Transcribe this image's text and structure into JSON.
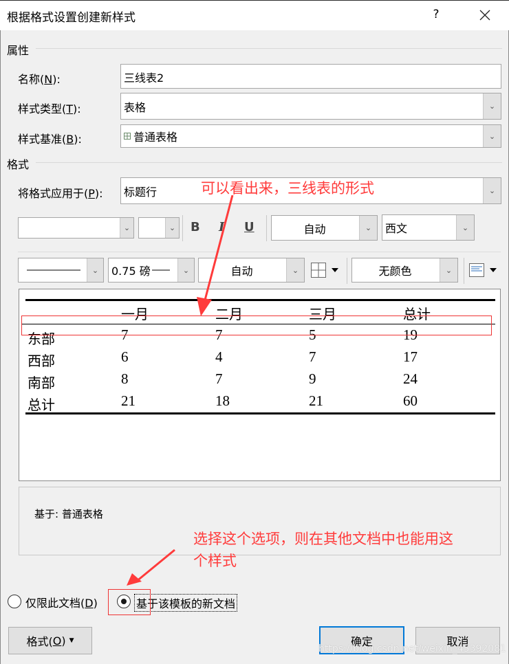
{
  "dialog": {
    "title": "根据格式设置创建新样式",
    "help_label": "?",
    "close_icon": "close-icon"
  },
  "properties": {
    "section_label": "属性",
    "name_label_pre": "名称(",
    "name_label_key": "N",
    "name_label_post": "):",
    "name_value": "三线表2",
    "type_label_pre": "样式类型(",
    "type_label_key": "T",
    "type_label_post": "):",
    "type_value": "表格",
    "base_label_pre": "样式基准(",
    "base_label_key": "B",
    "base_label_post": "):",
    "base_value": "普通表格",
    "base_icon": "table-style-icon"
  },
  "format": {
    "section_label": "格式",
    "apply_label_pre": "将格式应用于(",
    "apply_label_key": "P",
    "apply_label_post": "):",
    "apply_value": "标题行",
    "font_value": "",
    "size_value": "",
    "bold_label": "B",
    "italic_label": "I",
    "underline_label": "U",
    "color_value": "自动",
    "script_value": "西文",
    "border_style_value": "",
    "border_width_value": "0.75 磅",
    "border_color_value": "自动",
    "borders_icon": "borders-icon",
    "shading_value": "无颜色",
    "align_icon": "align-icon"
  },
  "preview_table": {
    "headers": [
      "",
      "一月",
      "二月",
      "三月",
      "总计"
    ],
    "rows": [
      [
        "东部",
        "7",
        "7",
        "5",
        "19"
      ],
      [
        "西部",
        "6",
        "4",
        "7",
        "17"
      ],
      [
        "南部",
        "8",
        "7",
        "9",
        "24"
      ],
      [
        "总计",
        "21",
        "18",
        "21",
        "60"
      ]
    ]
  },
  "description": {
    "text": "基于: 普通表格"
  },
  "scope": {
    "option1_pre": "仅限此文档(",
    "option1_key": "D",
    "option1_post": ")",
    "option1_checked": false,
    "option2_label": "基于该模板的新文档",
    "option2_checked": true
  },
  "buttons": {
    "format_pre": "格式(",
    "format_key": "O",
    "format_post": ")",
    "ok": "确定",
    "cancel": "取消"
  },
  "annotations": {
    "note1": "可以看出来，三线表的形式",
    "note2_line1": "选择这个选项，则在其他文档中也能用这",
    "note2_line2": "个样式",
    "color": "#ff3b3b"
  },
  "watermark": "https://blog.csdn.net/weixin_45392081"
}
